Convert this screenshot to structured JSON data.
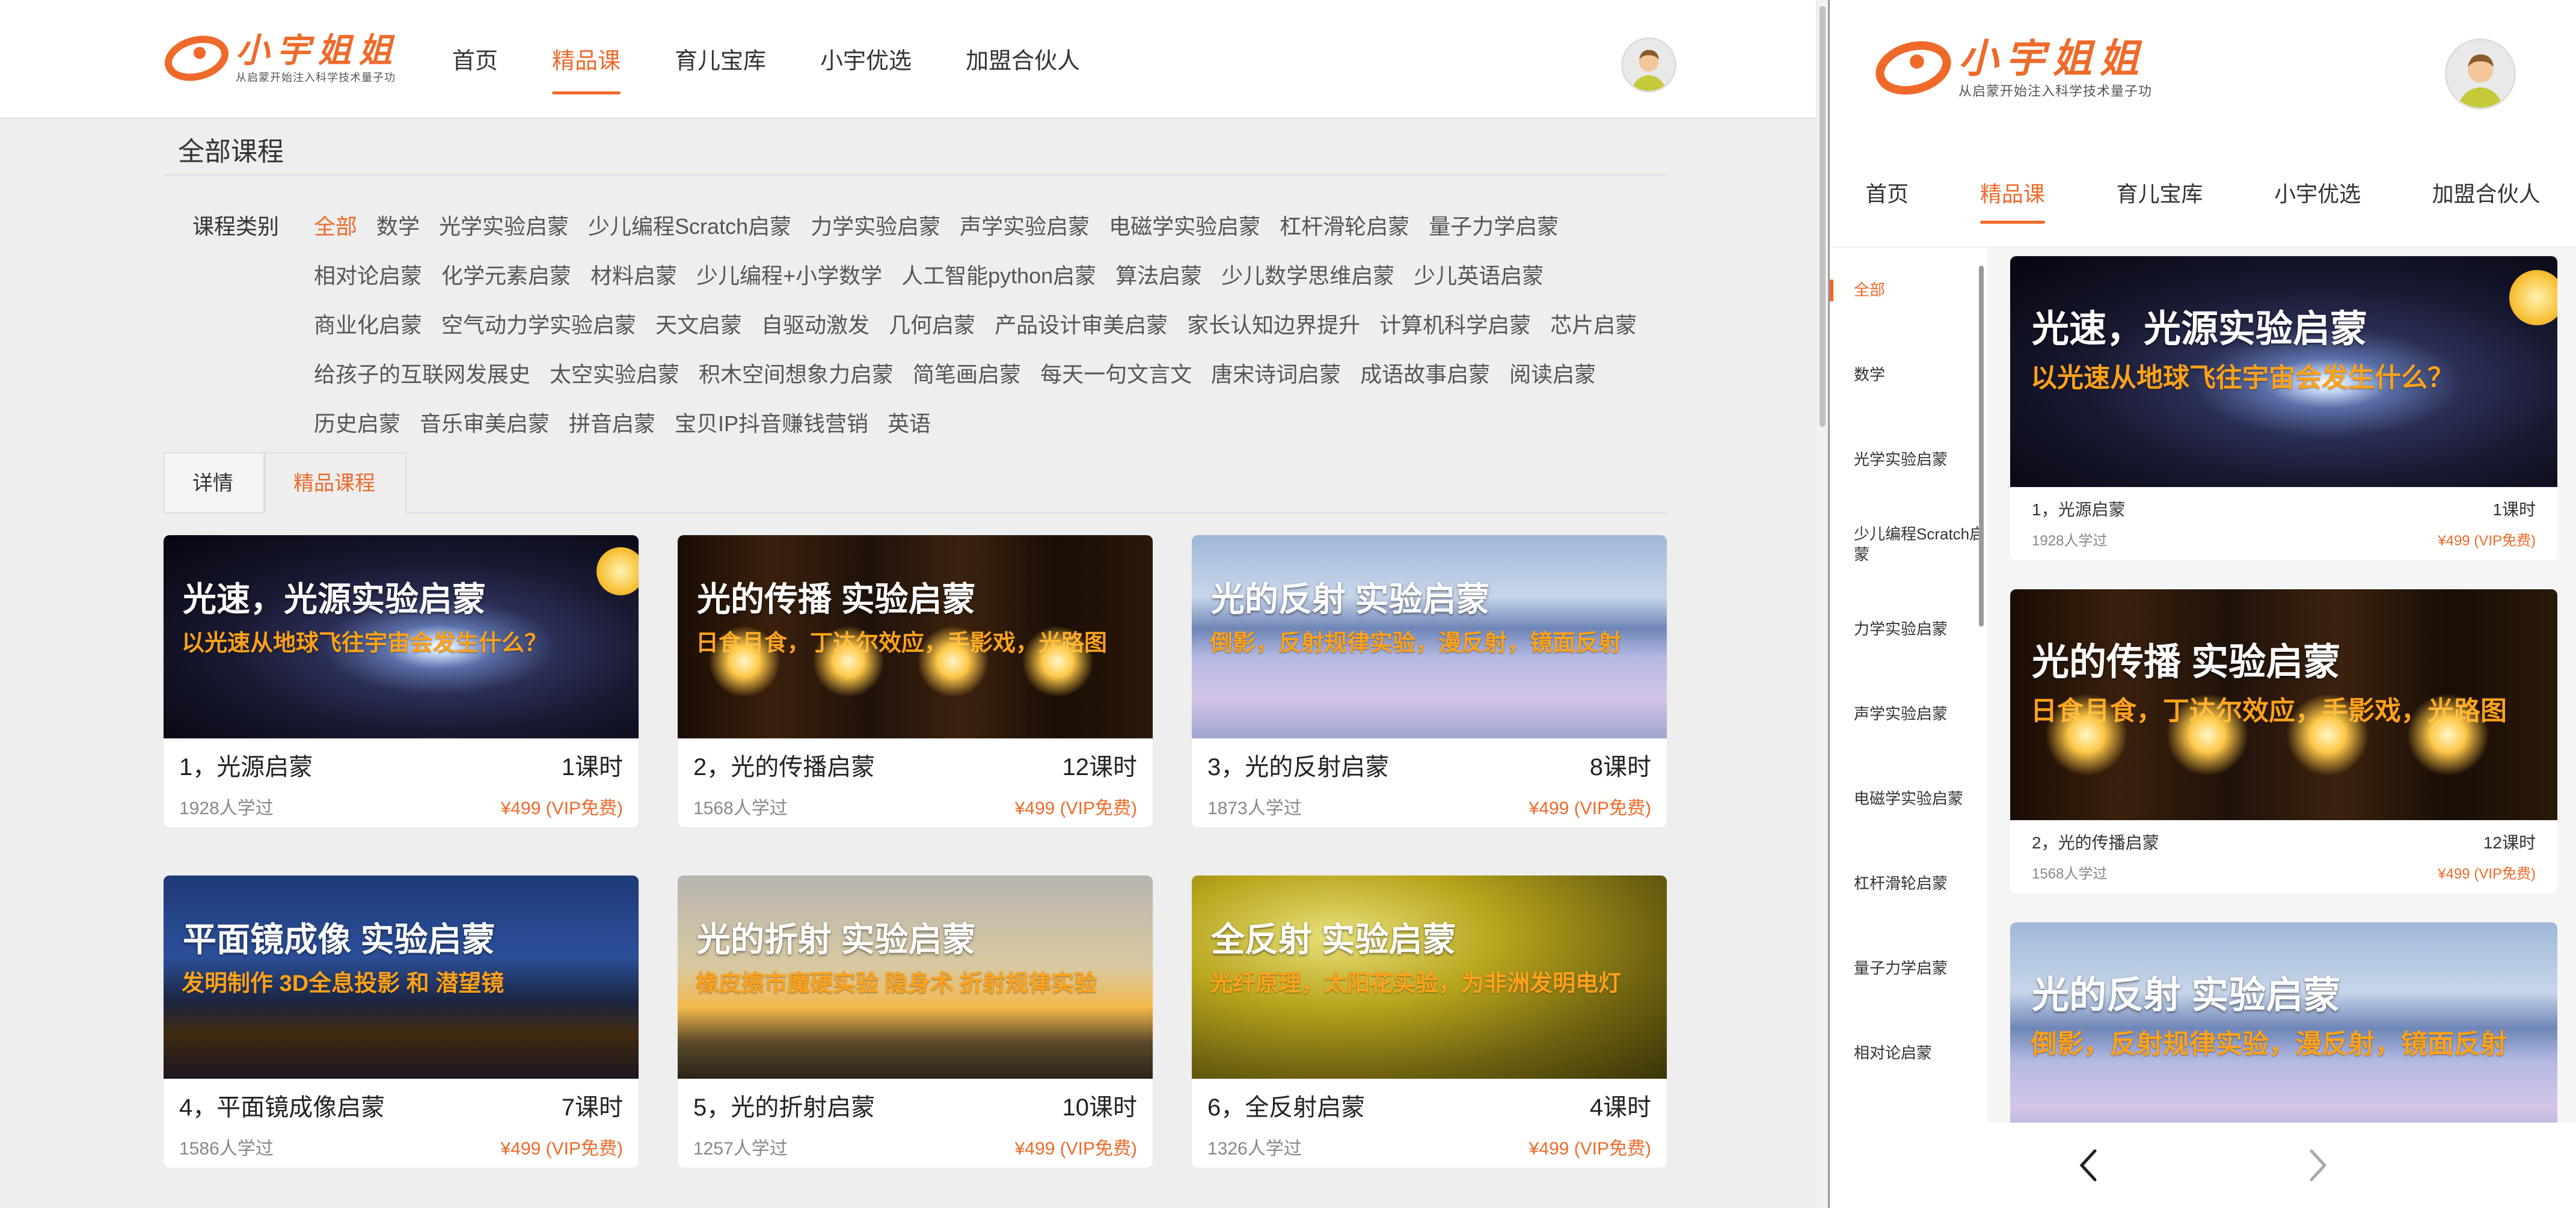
{
  "brand": {
    "name": "小宇姐姐",
    "slogan": "从启蒙开始注入科学技术量子功",
    "accent": "#ef6a2a"
  },
  "nav": {
    "items": [
      "首页",
      "精品课",
      "育儿宝库",
      "小宇优选",
      "加盟合伙人"
    ],
    "active_index": 1
  },
  "page": {
    "section_title": "全部课程",
    "category_label": "课程类别",
    "categories": [
      "全部",
      "数学",
      "光学实验启蒙",
      "少儿编程Scratch启蒙",
      "力学实验启蒙",
      "声学实验启蒙",
      "电磁学实验启蒙",
      "杠杆滑轮启蒙",
      "量子力学启蒙",
      "相对论启蒙",
      "化学元素启蒙",
      "材料启蒙",
      "少儿编程+小学数学",
      "人工智能python启蒙",
      "算法启蒙",
      "少儿数学思维启蒙",
      "少儿英语启蒙",
      "商业化启蒙",
      "空气动力学实验启蒙",
      "天文启蒙",
      "自驱动激发",
      "几何启蒙",
      "产品设计审美启蒙",
      "家长认知边界提升",
      "计算机科学启蒙",
      "芯片启蒙",
      "给孩子的互联网发展史",
      "太空实验启蒙",
      "积木空间想象力启蒙",
      "简笔画启蒙",
      "每天一句文言文",
      "唐宋诗词启蒙",
      "成语故事启蒙",
      "阅读启蒙",
      "历史启蒙",
      "音乐审美启蒙",
      "拼音启蒙",
      "宝贝IP抖音赚钱营销",
      "英语"
    ],
    "active_category_index": 0,
    "tabs": [
      "详情",
      "精品课程"
    ],
    "active_tab_index": 1
  },
  "courses": [
    {
      "title_img": "光速，光源实验启蒙",
      "sub_img": "以光速从地球飞往宇宙会发生什么？",
      "name": "1，光源启蒙",
      "lessons": "1课时",
      "learners": "1928人学过",
      "price": "¥499 (VIP免费)"
    },
    {
      "title_img": "光的传播 实验启蒙",
      "sub_img": "日食月食，丁达尔效应，手影戏，光路图",
      "name": "2，光的传播启蒙",
      "lessons": "12课时",
      "learners": "1568人学过",
      "price": "¥499 (VIP免费)"
    },
    {
      "title_img": "光的反射 实验启蒙",
      "sub_img": "倒影，反射规律实验，漫反射，镜面反射",
      "name": "3，光的反射启蒙",
      "lessons": "8课时",
      "learners": "1873人学过",
      "price": "¥499 (VIP免费)"
    },
    {
      "title_img": "平面镜成像 实验启蒙",
      "sub_img": "发明制作 3D全息投影 和 潜望镜",
      "name": "4，平面镜成像启蒙",
      "lessons": "7课时",
      "learners": "1586人学过",
      "price": "¥499 (VIP免费)"
    },
    {
      "title_img": "光的折射 实验启蒙",
      "sub_img": "橡皮擦市魔硬实验 隐身术 折射规律实验",
      "name": "5，光的折射启蒙",
      "lessons": "10课时",
      "learners": "1257人学过",
      "price": "¥499 (VIP免费)"
    },
    {
      "title_img": "全反射 实验启蒙",
      "sub_img": "光纤原理，太阳花实验，为非洲发明电灯",
      "name": "6，全反射启蒙",
      "lessons": "4课时",
      "learners": "1326人学过",
      "price": "¥499 (VIP免费)"
    }
  ],
  "mobile": {
    "sidebar": [
      "全部",
      "数学",
      "光学实验启蒙",
      "少儿编程Scratch启蒙",
      "力学实验启蒙",
      "声学实验启蒙",
      "电磁学实验启蒙",
      "杠杆滑轮启蒙",
      "量子力学启蒙",
      "相对论启蒙"
    ],
    "active_index": 0
  },
  "icons": {
    "prev": "chevron-left-icon",
    "next": "chevron-right-icon"
  }
}
